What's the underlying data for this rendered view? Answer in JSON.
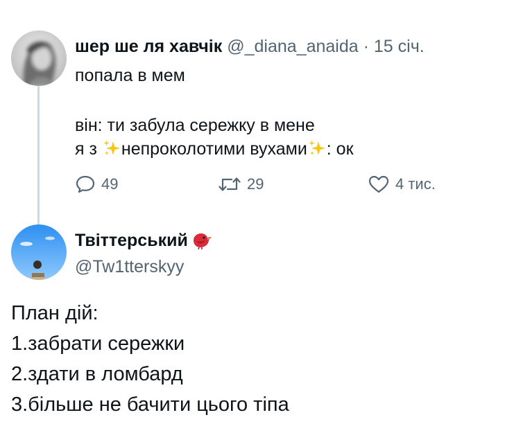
{
  "quoted_tweet": {
    "display_name": "шер ше ля хавчік",
    "handle": "@_diana_anaida",
    "separator": "·",
    "date": "15 січ.",
    "lines": [
      "попала в мем",
      "він: ти забула сережку в мене"
    ],
    "line3_before": "я з",
    "line3_middle": "непроколотими вухами",
    "line3_after": ": ок",
    "sparkle_icon": "sparkles-emoji",
    "actions": {
      "replies": "49",
      "retweets": "29",
      "likes": "4 тис."
    }
  },
  "reply_tweet": {
    "display_name": "Твіттерський",
    "handle": "@Tw1tterskyy",
    "bird_icon": "red-bird-emoji",
    "lines": [
      "План дій:",
      "1.забрати сережки",
      "2.здати в ломбард",
      "3.більше не бачити цього тіпа"
    ]
  },
  "colors": {
    "text": "#0f1419",
    "secondary": "#536471",
    "thread_line": "#cfd9de",
    "sparkle": "#f5c518",
    "bird": "#d92b3a"
  }
}
